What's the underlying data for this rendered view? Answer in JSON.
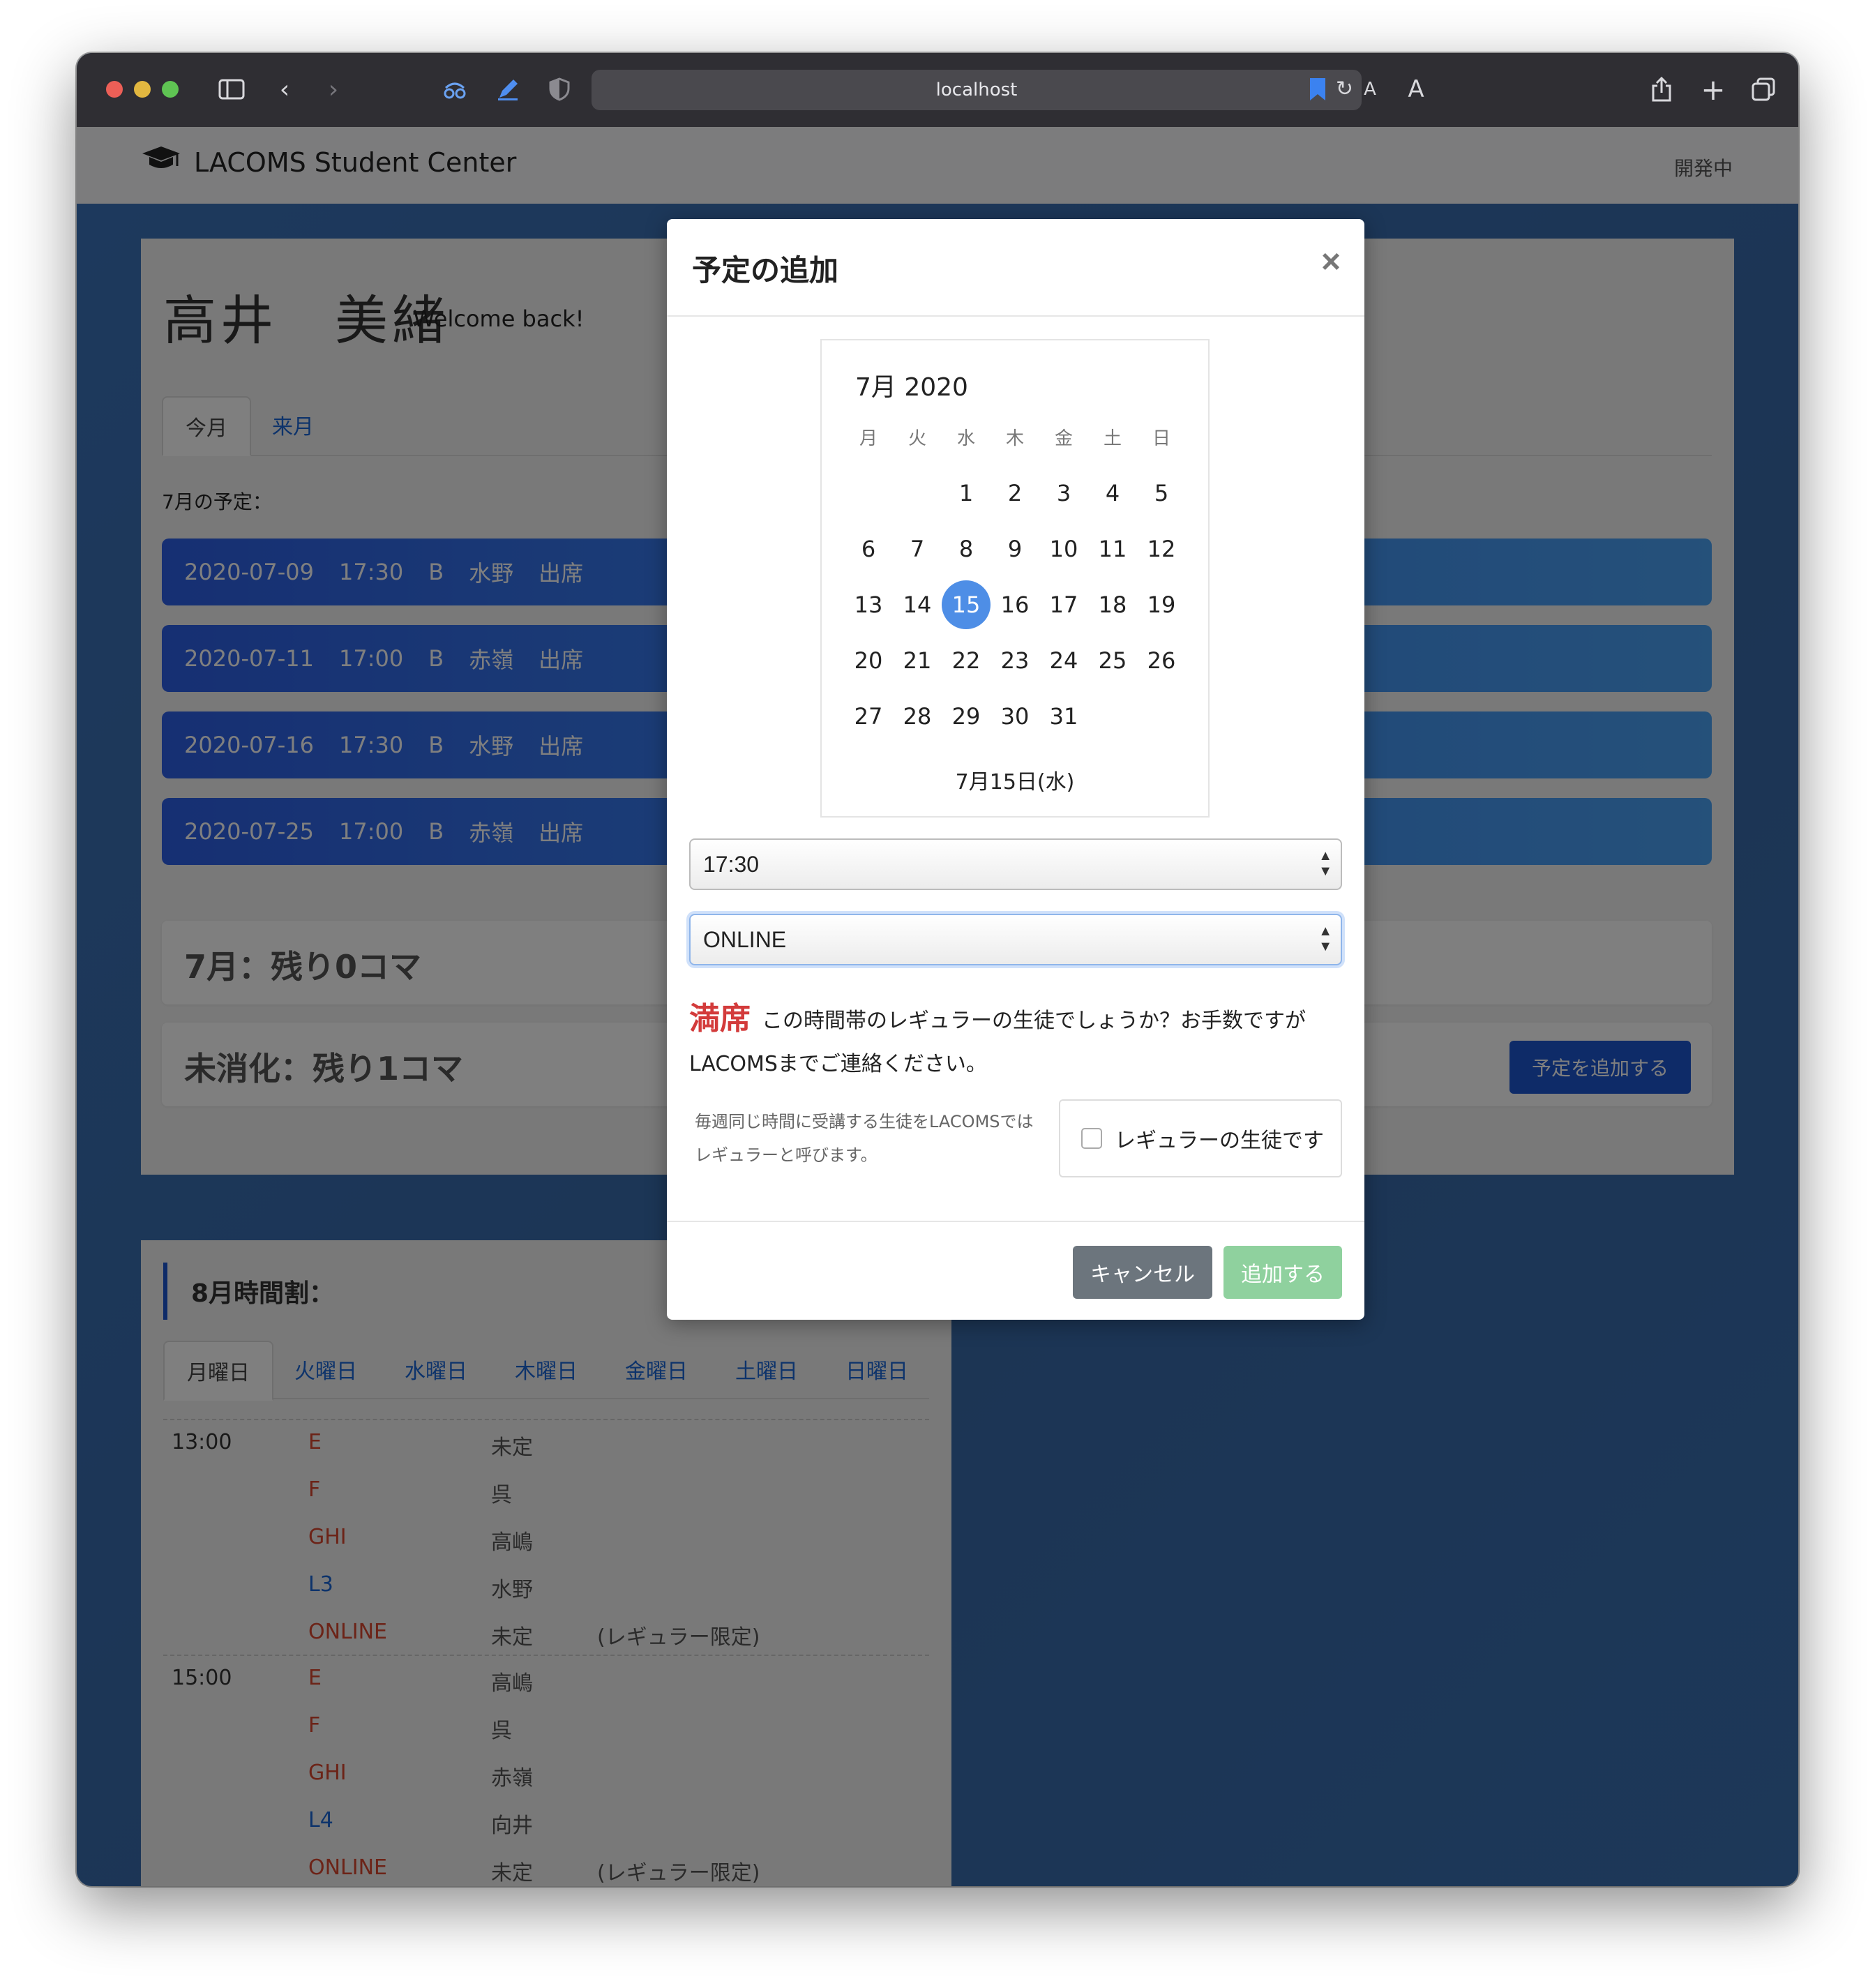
{
  "browser": {
    "url": "localhost"
  },
  "navbar": {
    "brand": "LACOMS Student Center",
    "status": "開発中"
  },
  "student": {
    "name": "高井　美緒",
    "welcome": "Welcome back!"
  },
  "month_tabs": [
    "今月",
    "来月"
  ],
  "schedule": {
    "label": "7月の予定：",
    "items": [
      {
        "date": "2020-07-09",
        "time": "17:30",
        "room": "B",
        "teacher": "水野",
        "status": "出席"
      },
      {
        "date": "2020-07-11",
        "time": "17:00",
        "room": "B",
        "teacher": "赤嶺",
        "status": "出席"
      },
      {
        "date": "2020-07-16",
        "time": "17:30",
        "room": "B",
        "teacher": "水野",
        "status": "出席"
      },
      {
        "date": "2020-07-25",
        "time": "17:00",
        "room": "B",
        "teacher": "赤嶺",
        "status": "出席"
      }
    ]
  },
  "remaining": {
    "month": "7月：残り0コマ",
    "unused": "未消化：残り1コマ",
    "add_button": "予定を追加する"
  },
  "timetable": {
    "title": "8月時間割：",
    "days": [
      "月曜日",
      "火曜日",
      "水曜日",
      "木曜日",
      "金曜日",
      "土曜日",
      "日曜日"
    ],
    "slots": [
      {
        "time": "13:00",
        "rows": [
          {
            "room": "E",
            "teacher": "未定",
            "note": ""
          },
          {
            "room": "F",
            "teacher": "呉",
            "note": ""
          },
          {
            "room": "GHI",
            "teacher": "高嶋",
            "note": ""
          },
          {
            "room": "L3",
            "teacher": "水野",
            "note": ""
          },
          {
            "room": "ONLINE",
            "teacher": "未定",
            "note": "(レギュラー限定)"
          }
        ]
      },
      {
        "time": "15:00",
        "rows": [
          {
            "room": "E",
            "teacher": "高嶋",
            "note": ""
          },
          {
            "room": "F",
            "teacher": "呉",
            "note": ""
          },
          {
            "room": "GHI",
            "teacher": "赤嶺",
            "note": ""
          },
          {
            "room": "L4",
            "teacher": "向井",
            "note": ""
          },
          {
            "room": "ONLINE",
            "teacher": "未定",
            "note": "(レギュラー限定)"
          }
        ]
      }
    ]
  },
  "modal": {
    "title": "予定の追加",
    "close_icon": "×",
    "calendar": {
      "header": "7月 2020",
      "weekdays": [
        "月",
        "火",
        "水",
        "木",
        "金",
        "土",
        "日"
      ],
      "days": [
        1,
        2,
        3,
        4,
        5,
        6,
        7,
        8,
        9,
        10,
        11,
        12,
        13,
        14,
        15,
        16,
        17,
        18,
        19,
        20,
        21,
        22,
        23,
        24,
        25,
        26,
        27,
        28,
        29,
        30,
        31
      ],
      "first_weekday_index": 2,
      "selected_day": 15,
      "selected_label": "7月15日(水)"
    },
    "time_select": "17:30",
    "room_select": "ONLINE",
    "full_word": "満席",
    "full_message_1": "この時間帯のレギュラーの生徒でしょうか？お手数ですが",
    "full_message_2": "LACOMSまでご連絡ください。",
    "regular_note": "毎週同じ時間に受講する生徒をLACOMSではレギュラーと呼びます。",
    "regular_checkbox_label": "レギュラーの生徒です",
    "regular_checked": false,
    "cancel": "キャンセル",
    "submit": "追加する"
  },
  "colors": {
    "accent": "#1d56d0",
    "schedule_gradient_start": "#2d5fe6",
    "schedule_gradient_end": "#4ba2f5",
    "full_red": "#d33b3b",
    "selected_day": "#4e8ee6"
  }
}
